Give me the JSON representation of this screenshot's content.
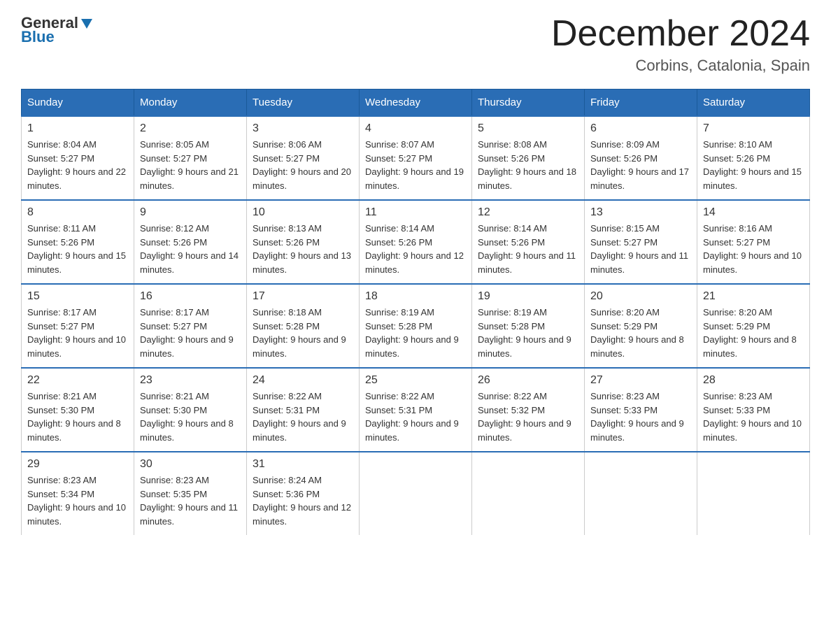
{
  "header": {
    "logo_general": "General",
    "logo_blue": "Blue",
    "month_title": "December 2024",
    "location": "Corbins, Catalonia, Spain"
  },
  "days_of_week": [
    "Sunday",
    "Monday",
    "Tuesday",
    "Wednesday",
    "Thursday",
    "Friday",
    "Saturday"
  ],
  "weeks": [
    [
      {
        "num": "1",
        "sunrise": "8:04 AM",
        "sunset": "5:27 PM",
        "daylight": "9 hours and 22 minutes."
      },
      {
        "num": "2",
        "sunrise": "8:05 AM",
        "sunset": "5:27 PM",
        "daylight": "9 hours and 21 minutes."
      },
      {
        "num": "3",
        "sunrise": "8:06 AM",
        "sunset": "5:27 PM",
        "daylight": "9 hours and 20 minutes."
      },
      {
        "num": "4",
        "sunrise": "8:07 AM",
        "sunset": "5:27 PM",
        "daylight": "9 hours and 19 minutes."
      },
      {
        "num": "5",
        "sunrise": "8:08 AM",
        "sunset": "5:26 PM",
        "daylight": "9 hours and 18 minutes."
      },
      {
        "num": "6",
        "sunrise": "8:09 AM",
        "sunset": "5:26 PM",
        "daylight": "9 hours and 17 minutes."
      },
      {
        "num": "7",
        "sunrise": "8:10 AM",
        "sunset": "5:26 PM",
        "daylight": "9 hours and 15 minutes."
      }
    ],
    [
      {
        "num": "8",
        "sunrise": "8:11 AM",
        "sunset": "5:26 PM",
        "daylight": "9 hours and 15 minutes."
      },
      {
        "num": "9",
        "sunrise": "8:12 AM",
        "sunset": "5:26 PM",
        "daylight": "9 hours and 14 minutes."
      },
      {
        "num": "10",
        "sunrise": "8:13 AM",
        "sunset": "5:26 PM",
        "daylight": "9 hours and 13 minutes."
      },
      {
        "num": "11",
        "sunrise": "8:14 AM",
        "sunset": "5:26 PM",
        "daylight": "9 hours and 12 minutes."
      },
      {
        "num": "12",
        "sunrise": "8:14 AM",
        "sunset": "5:26 PM",
        "daylight": "9 hours and 11 minutes."
      },
      {
        "num": "13",
        "sunrise": "8:15 AM",
        "sunset": "5:27 PM",
        "daylight": "9 hours and 11 minutes."
      },
      {
        "num": "14",
        "sunrise": "8:16 AM",
        "sunset": "5:27 PM",
        "daylight": "9 hours and 10 minutes."
      }
    ],
    [
      {
        "num": "15",
        "sunrise": "8:17 AM",
        "sunset": "5:27 PM",
        "daylight": "9 hours and 10 minutes."
      },
      {
        "num": "16",
        "sunrise": "8:17 AM",
        "sunset": "5:27 PM",
        "daylight": "9 hours and 9 minutes."
      },
      {
        "num": "17",
        "sunrise": "8:18 AM",
        "sunset": "5:28 PM",
        "daylight": "9 hours and 9 minutes."
      },
      {
        "num": "18",
        "sunrise": "8:19 AM",
        "sunset": "5:28 PM",
        "daylight": "9 hours and 9 minutes."
      },
      {
        "num": "19",
        "sunrise": "8:19 AM",
        "sunset": "5:28 PM",
        "daylight": "9 hours and 9 minutes."
      },
      {
        "num": "20",
        "sunrise": "8:20 AM",
        "sunset": "5:29 PM",
        "daylight": "9 hours and 8 minutes."
      },
      {
        "num": "21",
        "sunrise": "8:20 AM",
        "sunset": "5:29 PM",
        "daylight": "9 hours and 8 minutes."
      }
    ],
    [
      {
        "num": "22",
        "sunrise": "8:21 AM",
        "sunset": "5:30 PM",
        "daylight": "9 hours and 8 minutes."
      },
      {
        "num": "23",
        "sunrise": "8:21 AM",
        "sunset": "5:30 PM",
        "daylight": "9 hours and 8 minutes."
      },
      {
        "num": "24",
        "sunrise": "8:22 AM",
        "sunset": "5:31 PM",
        "daylight": "9 hours and 9 minutes."
      },
      {
        "num": "25",
        "sunrise": "8:22 AM",
        "sunset": "5:31 PM",
        "daylight": "9 hours and 9 minutes."
      },
      {
        "num": "26",
        "sunrise": "8:22 AM",
        "sunset": "5:32 PM",
        "daylight": "9 hours and 9 minutes."
      },
      {
        "num": "27",
        "sunrise": "8:23 AM",
        "sunset": "5:33 PM",
        "daylight": "9 hours and 9 minutes."
      },
      {
        "num": "28",
        "sunrise": "8:23 AM",
        "sunset": "5:33 PM",
        "daylight": "9 hours and 10 minutes."
      }
    ],
    [
      {
        "num": "29",
        "sunrise": "8:23 AM",
        "sunset": "5:34 PM",
        "daylight": "9 hours and 10 minutes."
      },
      {
        "num": "30",
        "sunrise": "8:23 AM",
        "sunset": "5:35 PM",
        "daylight": "9 hours and 11 minutes."
      },
      {
        "num": "31",
        "sunrise": "8:24 AM",
        "sunset": "5:36 PM",
        "daylight": "9 hours and 12 minutes."
      },
      null,
      null,
      null,
      null
    ]
  ]
}
